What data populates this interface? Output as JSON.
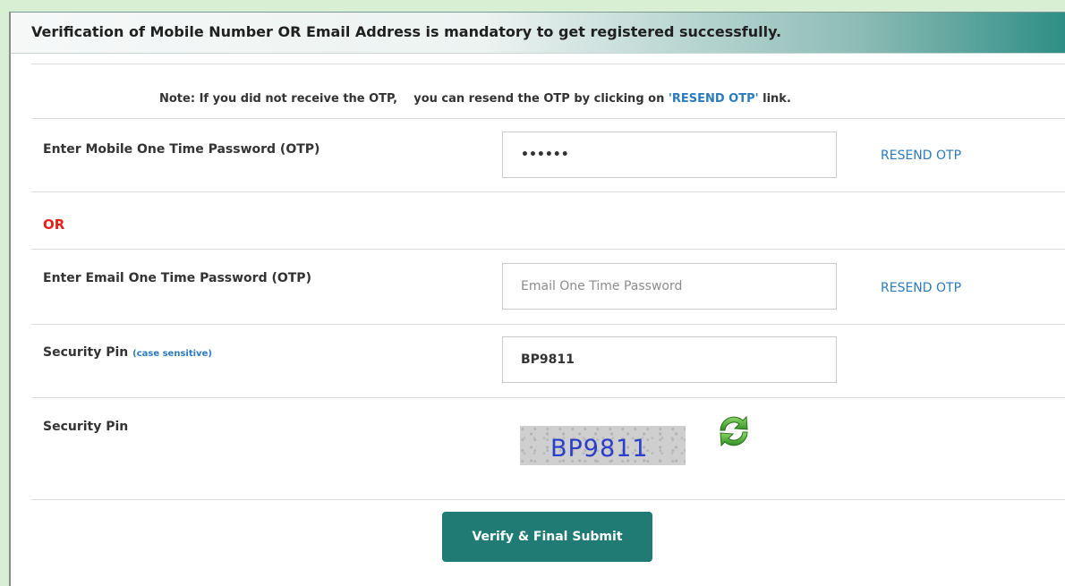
{
  "header": {
    "title": "Verification of Mobile Number OR Email Address is mandatory to get registered successfully."
  },
  "note": {
    "prefix": "Note: If you did not receive the OTP,    you can resend the OTP by clicking on ",
    "highlight": "'RESEND OTP'",
    "suffix": " link."
  },
  "mobile_otp": {
    "label": "Enter Mobile One Time Password (OTP)",
    "value": "••••••",
    "resend_label": "RESEND OTP"
  },
  "or_label": "OR",
  "email_otp": {
    "label": "Enter Email One Time Password (OTP)",
    "placeholder": "Email One Time Password",
    "value": "",
    "resend_label": "RESEND OTP"
  },
  "security_pin_input": {
    "label": "Security Pin",
    "hint": "(case sensitive)",
    "value": "BP9811"
  },
  "security_pin_captcha": {
    "label": "Security Pin",
    "captcha_text": "BP9811",
    "refresh_icon": "refresh-icon"
  },
  "submit": {
    "label": "Verify & Final Submit"
  },
  "colors": {
    "accent": "#1f7b73",
    "link": "#2b7bbf",
    "or": "#e8201a",
    "captcha_text": "#2a3ec9"
  }
}
